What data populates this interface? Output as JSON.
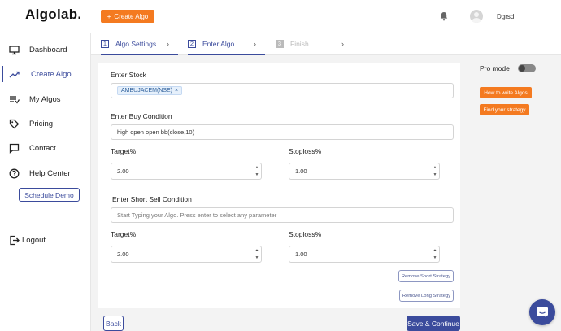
{
  "brand": {
    "logo": "Algolab."
  },
  "topbar": {
    "create_label": "Create Algo",
    "create_icon": "+",
    "username": "Dgrsd"
  },
  "sidebar": {
    "items": [
      {
        "label": "Dashboard",
        "icon": "monitor-icon"
      },
      {
        "label": "Create Algo",
        "icon": "trend-icon",
        "active": true
      },
      {
        "label": "My Algos",
        "icon": "list-icon"
      },
      {
        "label": "Pricing",
        "icon": "tag-icon"
      },
      {
        "label": "Contact",
        "icon": "chat-icon"
      },
      {
        "label": "Help Center",
        "icon": "help-icon"
      }
    ],
    "schedule_label": "Schedule Demo",
    "logout_label": "Logout"
  },
  "steps": [
    {
      "num": "1",
      "label": "Algo Settings"
    },
    {
      "num": "2",
      "label": "Enter Algo"
    },
    {
      "num": "3",
      "label": "Finish"
    }
  ],
  "form": {
    "stock_label": "Enter Stock",
    "stock_chip": "AMBUJACEM(NSE)",
    "chip_remove": "×",
    "buy_label": "Enter Buy Condition",
    "buy_value": "high open open bb(close,10)",
    "target_label": "Target%",
    "target_value": "2.00",
    "stoploss_label": "Stoploss%",
    "stoploss_value": "1.00",
    "short_label": "Enter Short Sell Condition",
    "short_placeholder": "Start Typing your Algo. Press enter to select any parameter",
    "short_target_label": "Target%",
    "short_target_value": "2.00",
    "short_stoploss_label": "Stoploss%",
    "short_stoploss_value": "1.00",
    "remove_short_label": "Remove Short Strategy",
    "remove_long_label": "Remove Long Strategy",
    "spin_up": "▲",
    "spin_down": "▼"
  },
  "footer": {
    "back_label": "Back",
    "save_label": "Save & Continue"
  },
  "right_panel": {
    "pro_mode_label": "Pro mode",
    "pro_mode_on": false,
    "how_to_label": "How to write Algos",
    "find_strategy_label": "Find your strategy"
  },
  "colors": {
    "accent": "#3b4b9c",
    "orange": "#f47a20",
    "background": "#f3f3f3"
  }
}
